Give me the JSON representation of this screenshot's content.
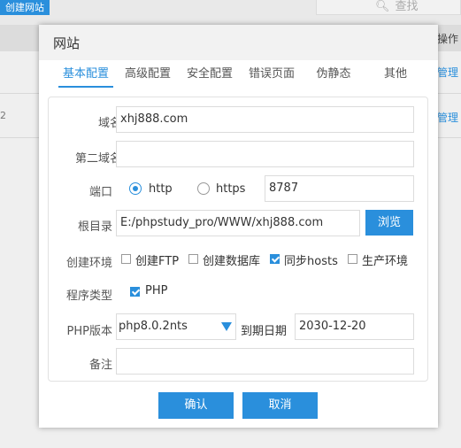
{
  "background": {
    "create_site_button": "创建网站",
    "search_placeholder": "查找",
    "operation_header": "操作",
    "manage_link_1": "管理",
    "manage_link_2": "管理",
    "row_mark": "2"
  },
  "dialog": {
    "title": "网站",
    "tabs": [
      "基本配置",
      "高级配置",
      "安全配置",
      "错误页面",
      "伪静态",
      "其他"
    ],
    "active_tab": 0,
    "fields": {
      "domain": {
        "label": "域名",
        "value": "xhj888.com"
      },
      "second_domain": {
        "label": "第二域名",
        "value": ""
      },
      "port": {
        "label": "端口",
        "http_label": "http",
        "https_label": "https",
        "selected": "http",
        "value": "8787"
      },
      "root_dir": {
        "label": "根目录",
        "value": "E:/phpstudy_pro/WWW/xhj888.com",
        "browse_label": "浏览"
      },
      "env": {
        "label": "创建环境",
        "options": [
          {
            "label": "创建FTP",
            "checked": false
          },
          {
            "label": "创建数据库",
            "checked": false
          },
          {
            "label": "同步hosts",
            "checked": true
          },
          {
            "label": "生产环境",
            "checked": false
          }
        ]
      },
      "program_type": {
        "label": "程序类型",
        "option": "PHP",
        "checked": true
      },
      "php_version": {
        "label": "PHP版本",
        "value": "php8.0.2nts"
      },
      "expire_date": {
        "label": "到期日期",
        "value": "2030-12-20"
      },
      "remark": {
        "label": "备注",
        "value": ""
      }
    },
    "ok_label": "确认",
    "cancel_label": "取消"
  },
  "colors": {
    "accent": "#2a8fdc",
    "panel_border": "#e2e2e2",
    "title_bg": "#f2f2f2"
  }
}
